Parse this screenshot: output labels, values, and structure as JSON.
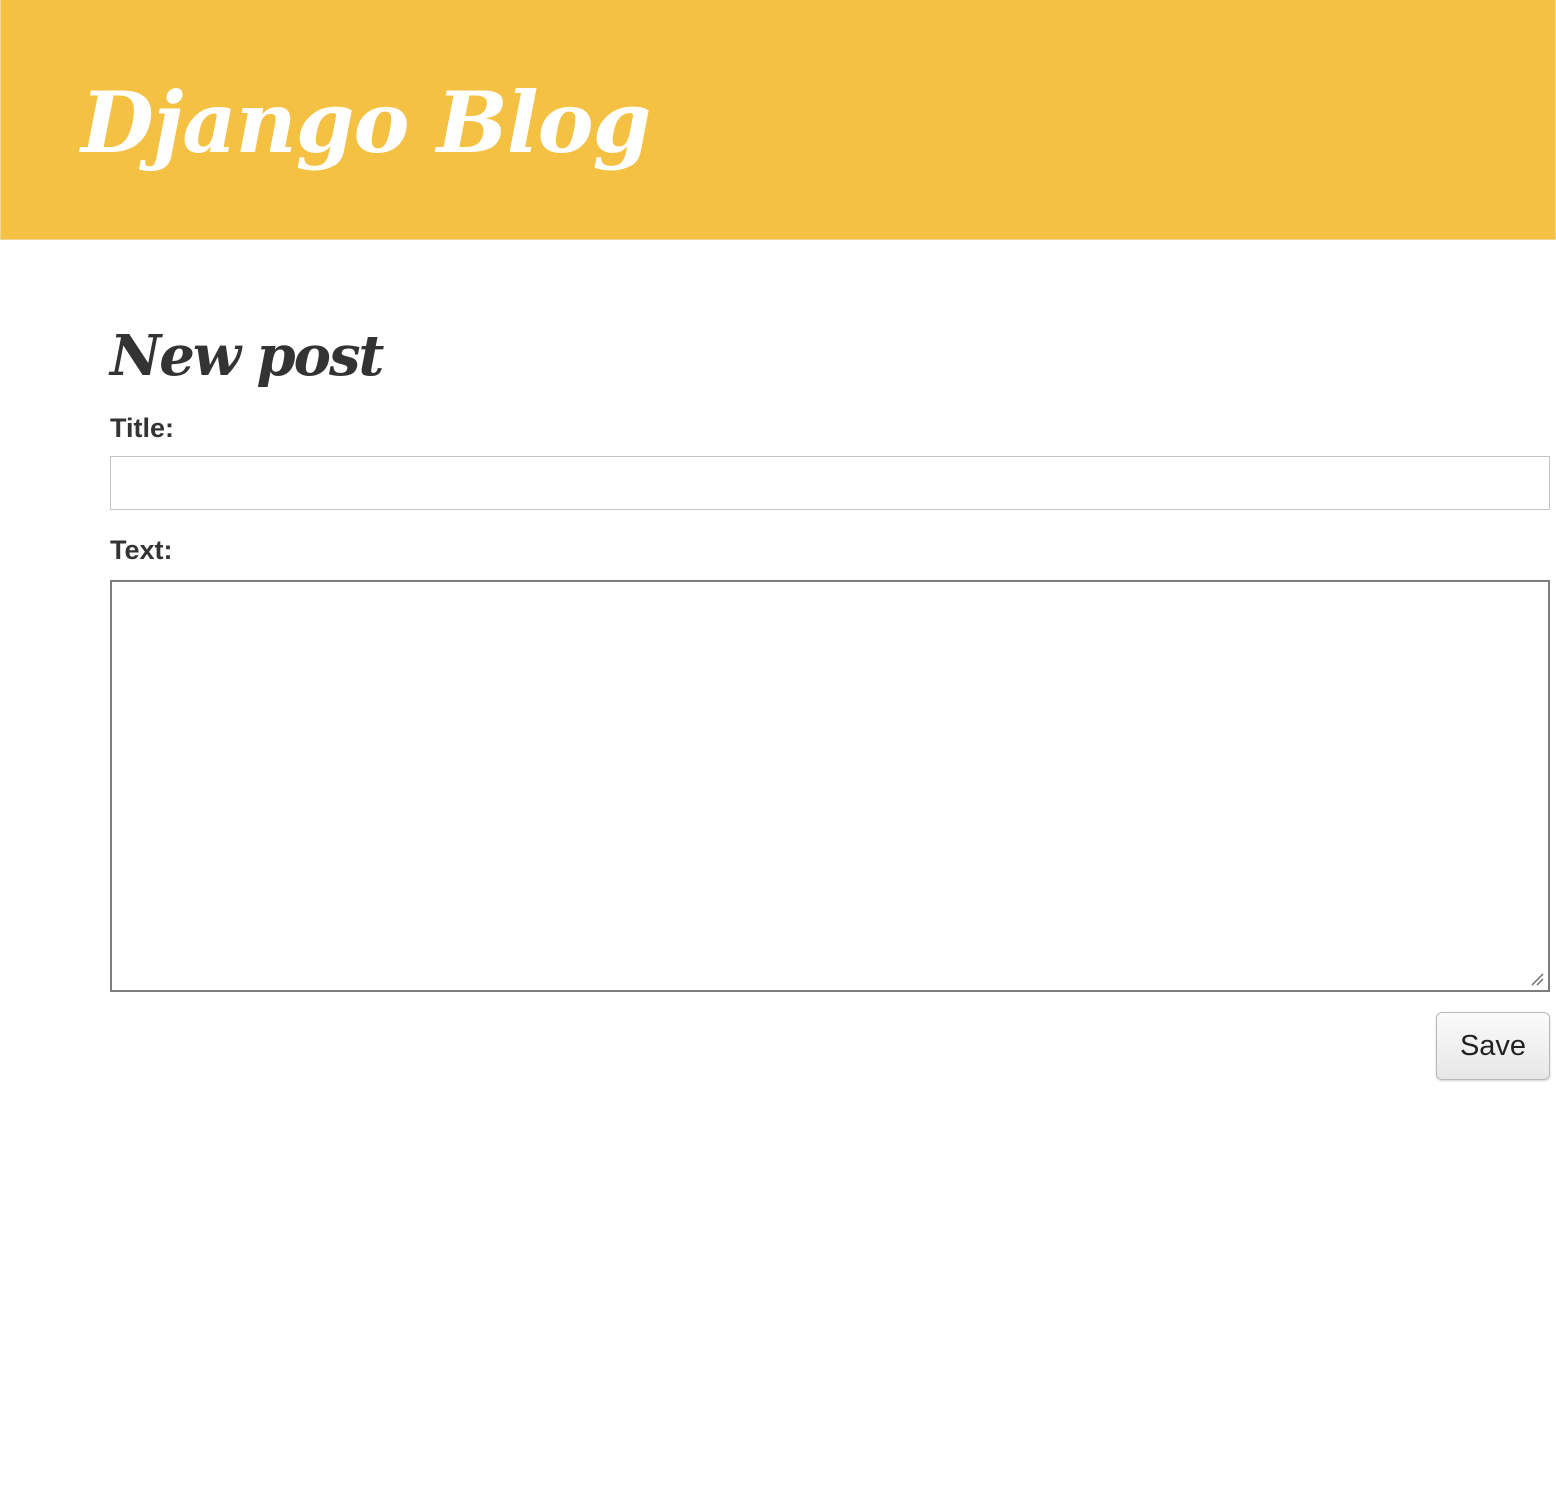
{
  "header": {
    "site_title": "Django Blog",
    "background_color": "#f5c142",
    "title_color": "#ffffff"
  },
  "form": {
    "page_title": "New post",
    "title_label": "Title:",
    "title_value": "",
    "text_label": "Text:",
    "text_value": "",
    "save_label": "Save"
  },
  "icons": {
    "textarea_resize": "resize-grip-icon"
  }
}
